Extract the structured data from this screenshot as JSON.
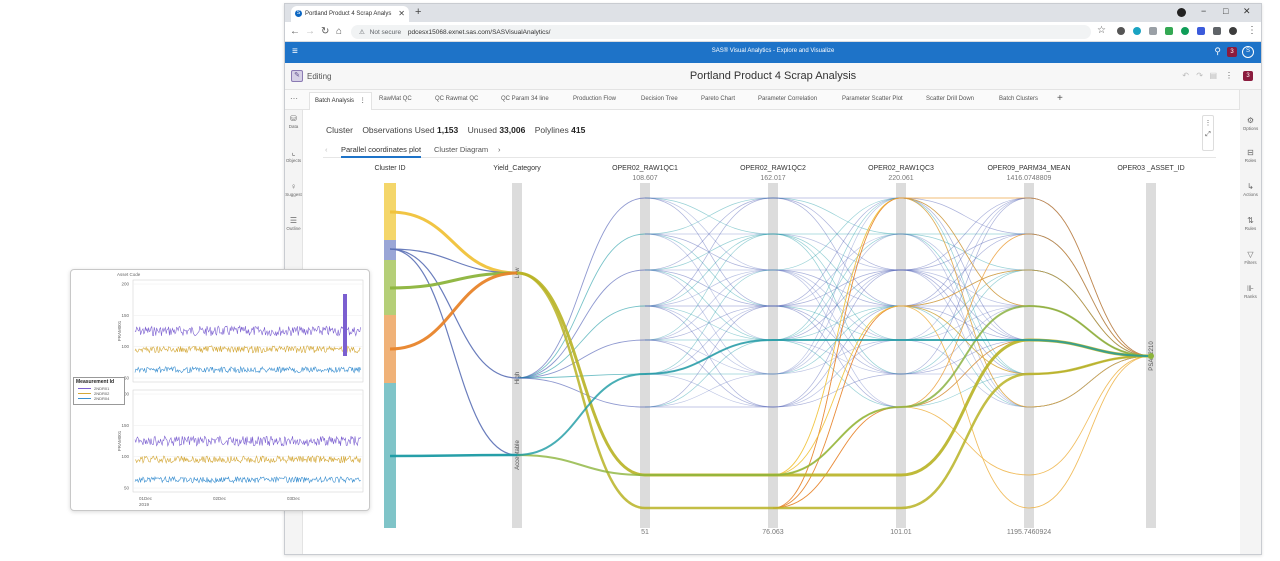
{
  "browser": {
    "tab_title": "Portland Product 4 Scrap Analys",
    "tab_favicon": "S",
    "url_warning": "Not secure",
    "url": "pdcesx15068.exnet.sas.com/SASVisualAnalytics/",
    "controls": {
      "minimize": "−",
      "maximize": "□",
      "close": "✕",
      "new_tab": "+"
    }
  },
  "app": {
    "title": "SAS® Visual Analytics - Explore and Visualize",
    "user_badge": "3",
    "user_initial": "S"
  },
  "report": {
    "mode": "Editing",
    "title": "Portland Product 4 Scrap Analysis",
    "badge": "3"
  },
  "page_tabs": [
    "Batch Analysis",
    "RawMat QC",
    "QC Rawmat QC",
    "QC Param 34 line",
    "Production Flow",
    "Decision Tree",
    "Pareto Chart",
    "Parameter Correlation",
    "Parameter Scatter Plot",
    "Scatter Drill Down",
    "Batch Clusters"
  ],
  "left_pane": [
    {
      "icon": "database-icon",
      "label": "Data"
    },
    {
      "icon": "objects-icon",
      "label": "Objects"
    },
    {
      "icon": "suggest-icon",
      "label": "Suggest"
    },
    {
      "icon": "outline-icon",
      "label": "Outline"
    }
  ],
  "right_pane": [
    {
      "icon": "options-icon",
      "label": "Options"
    },
    {
      "icon": "roles-icon",
      "label": "Roles"
    },
    {
      "icon": "actions-icon",
      "label": "Actions"
    },
    {
      "icon": "rules-icon",
      "label": "Rules"
    },
    {
      "icon": "filters-icon",
      "label": "Filters"
    },
    {
      "icon": "ranks-icon",
      "label": "Ranks"
    }
  ],
  "summary": {
    "name": "Cluster",
    "obs_label": "Observations Used",
    "obs_value": "1,153",
    "unused_label": "Unused",
    "unused_value": "33,006",
    "poly_label": "Polylines",
    "poly_value": "415"
  },
  "chart_tabs": [
    "Parallel coordinates plot",
    "Cluster Diagram"
  ],
  "chart_data": {
    "type": "parallel-coordinates",
    "axes": [
      {
        "name": "Cluster ID"
      },
      {
        "name": "Yield_Category",
        "categories": [
          "Low",
          "High",
          "Acceptable"
        ]
      },
      {
        "name": "OPER02_RAW1QC1",
        "max": "108.607",
        "min": "51"
      },
      {
        "name": "OPER02_RAW1QC2",
        "max": "162.017",
        "min": "76.063"
      },
      {
        "name": "OPER02_RAW1QC3",
        "max": "220.061",
        "min": "101.01"
      },
      {
        "name": "OPER09_PARM34_MEAN",
        "max": "1416.0748809",
        "min": "1195.7460924"
      },
      {
        "name": "OPER03 _ASSET_ID",
        "categories": [
          "PSAP2210"
        ]
      }
    ],
    "colors": {
      "yellow": "#f0c23a",
      "blue": "#5a6fb5",
      "green": "#8cb43c",
      "orange": "#e8842a",
      "teal": "#1a9aa3",
      "olive": "#b8b324"
    }
  },
  "inset": {
    "panel_title": "Asset Code",
    "legend_title": "Measurement Id",
    "legend_items": [
      "2NDR01",
      "2NDR02",
      "2NDR04"
    ],
    "legend_colors": [
      "#7b5fd0",
      "#d4a838",
      "#3a8fd0"
    ],
    "y_label_top": "PRAM001",
    "y_label_bottom": "PRAM001",
    "y_ticks_top": [
      "200",
      "150",
      "100",
      "50"
    ],
    "y_ticks_bottom": [
      "200",
      "150",
      "100",
      "50"
    ],
    "x_ticks": [
      "01Dec",
      "02Dec",
      "03Dec"
    ],
    "x_year": "2019"
  }
}
